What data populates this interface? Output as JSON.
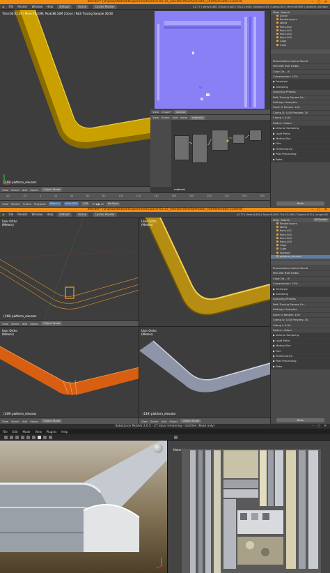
{
  "blender_top": {
    "title": "Blender* [D:\\p\\opl\\todo\\artExperiments\\2016-05-25_elevator\\fixed\\elevator_shaft\\elevator.3.blend]",
    "menus": [
      "File",
      "Render",
      "Window",
      "Help"
    ],
    "layout": "Default",
    "scene": "Scene",
    "engine": "Cycles Render",
    "stats": "v2.77 | Verts:6,480 | Faces:6,480 | Tris:12,960 | Objects:0/19 | Lamps:0/0 | Mem:68.58M | platform_elevator",
    "viewport_status": [
      "Time:00:02.00 | Mem:76.43M, Peak:86.14M | Done | Path Tracing Sample 30/30"
    ],
    "viewport_footer": "(149) platform_elevator",
    "view_menus": [
      "View",
      "Select",
      "Add",
      "Object"
    ],
    "mode": "Object Mode",
    "image_menus": [
      "View",
      "Image*"
    ],
    "image_name": "normal",
    "node_menus": [
      "View",
      "Select",
      "Add",
      "Node"
    ],
    "node_material": "material",
    "node_footer": "material",
    "outliner_items": [
      {
        "label": "Scene",
        "sel": false
      },
      {
        "label": "RenderLayers",
        "sel": false
      },
      {
        "label": "World",
        "sel": false
      },
      {
        "label": "Point.002",
        "sel": false
      },
      {
        "label": "Point.003",
        "sel": false
      },
      {
        "label": "Point.004",
        "sel": false
      },
      {
        "label": "Point.005",
        "sel": false
      },
      {
        "label": "Cage",
        "sel": false
      },
      {
        "label": "Cube",
        "sel": false
      }
    ],
    "props": [
      {
        "label": "Placeholders   Cache Result",
        "bar": false
      },
      {
        "label": "PNG   BW  RGB  RGBA",
        "bar": false
      },
      {
        "label": "Color De...  8",
        "bar": false
      },
      {
        "label": "Compression:  15%",
        "bar": false
      },
      {
        "label": "▶ Freestyle",
        "bar": true
      },
      {
        "label": "▶ Sampling",
        "bar": true
      },
      {
        "label": "Sampling Presets",
        "bar": false
      },
      {
        "label": "Path Tracing   Square Sa...",
        "bar": false
      },
      {
        "label": "Settings:   Samples:",
        "bar": false
      },
      {
        "label": "Seed: 0    Render: 100",
        "bar": false
      },
      {
        "label": "Clamp D: 0.00   Preview: 30",
        "bar": false
      },
      {
        "label": "Clamp I: 0.00",
        "bar": false
      },
      {
        "label": "Pattern:   Sobol",
        "bar": false
      },
      {
        "label": "▶ Volume Sampling",
        "bar": true
      },
      {
        "label": "▶ Light Paths",
        "bar": true
      },
      {
        "label": "▶ Motion Blur",
        "bar": true
      },
      {
        "label": "▶ Film",
        "bar": true
      },
      {
        "label": "▶ Performance",
        "bar": true
      },
      {
        "label": "▶ Post Processing",
        "bar": true
      },
      {
        "label": "▶ Bake",
        "bar": true
      }
    ],
    "bake_button": "Bake",
    "timeline_ticks": [
      "-40",
      "-20",
      "0",
      "20",
      "40",
      "60",
      "80",
      "100",
      "120",
      "140",
      "160",
      "180",
      "200",
      "220",
      "240",
      "260"
    ],
    "timeline_menus": [
      "View",
      "Marker",
      "Frame",
      "Playback"
    ],
    "start_label": "Start:",
    "start_value": "1",
    "end_label": "End:",
    "end_value": "250",
    "current_frame": "149",
    "sync": "No Sync"
  },
  "blender_mid": {
    "title": "Blender* [D:\\p\\opl\\todo\\artExperiments\\2016-05-25_elevator\\fixed\\elevator_shaft\\elevator.3.blend]",
    "stats": "v2.77 | Verts:6,480 | Faces:6,480 | Tris:12,960 | Objects:0/19 | Lamps:0/0",
    "quad_labels": [
      {
        "title": "User Ortho",
        "sub": "(Meters)"
      },
      {
        "title": "User Ortho",
        "sub": "(Meters)"
      },
      {
        "title": "User Ortho",
        "sub": "(Meters)"
      },
      {
        "title": "User Ortho",
        "sub": "(Meters)"
      }
    ],
    "quad_footer": "(149) platform_elevator",
    "outliner_items": [
      {
        "label": "RenderLayers",
        "sel": false
      },
      {
        "label": "World",
        "sel": false
      },
      {
        "label": "Point.002",
        "sel": false
      },
      {
        "label": "Point.003",
        "sel": false
      },
      {
        "label": "Point.004",
        "sel": false
      },
      {
        "label": "Point.005",
        "sel": false
      },
      {
        "label": "Cage",
        "sel": false
      },
      {
        "label": "Cube",
        "sel": false
      },
      {
        "label": "highpoly",
        "sel": false
      },
      {
        "label": "platform_elevato",
        "sel": true
      }
    ],
    "search_tab": "All Scenes"
  },
  "substance": {
    "title": "Substance Painter 2.0.5 - 27 days remaining - Untitled (Read only)",
    "menus": [
      "File",
      "Edit",
      "Mode",
      "View",
      "Plugins",
      "Help"
    ],
    "viewport_2d_label": "Material"
  }
}
